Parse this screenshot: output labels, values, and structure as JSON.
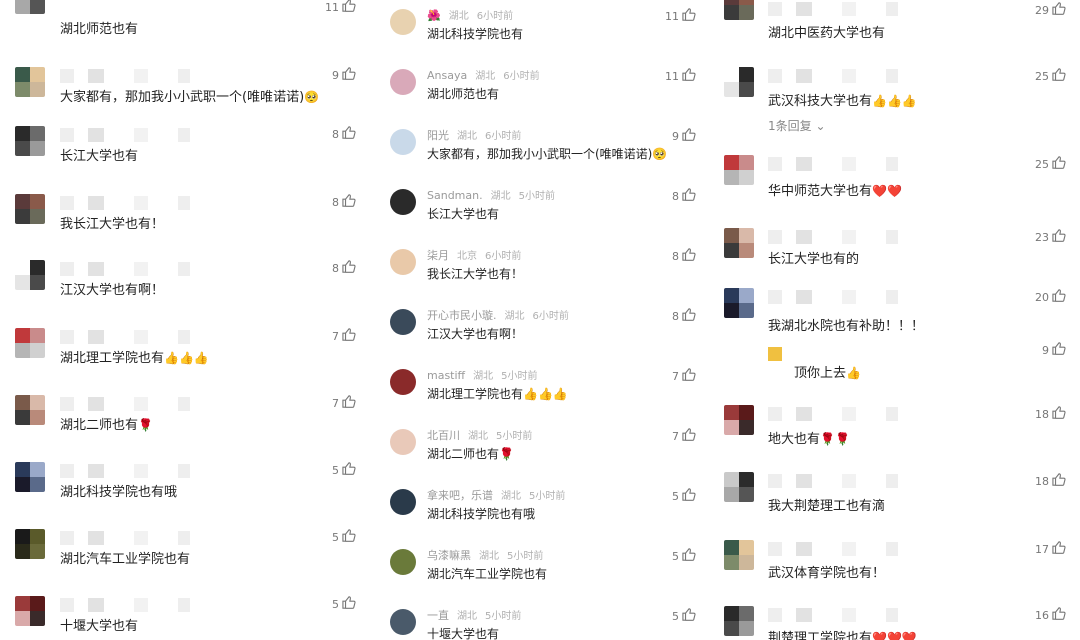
{
  "col1": {
    "comments": [
      {
        "name": "",
        "text": "湖北师范也有",
        "likes": "11"
      },
      {
        "name": "",
        "text": "大家都有，那加我小小武职一个(唯唯诺诺)",
        "suffix": "🥺",
        "likes": "9"
      },
      {
        "name": "",
        "text": "长江大学也有",
        "likes": "8"
      },
      {
        "name": "",
        "text": "我长江大学也有！",
        "likes": "8"
      },
      {
        "name": "",
        "text": "江汉大学也有啊！",
        "likes": "8"
      },
      {
        "name": "",
        "text": "湖北理工学院也有",
        "suffix": "👍👍👍",
        "likes": "7"
      },
      {
        "name": "",
        "text": "湖北二师也有",
        "suffix": "🌹",
        "likes": "7"
      },
      {
        "name": "",
        "text": "湖北科技学院也有哦",
        "likes": "5"
      },
      {
        "name": "",
        "text": "湖北汽车工业学院也有",
        "likes": "5"
      },
      {
        "name": "",
        "text": "十堰大学也有",
        "likes": "5"
      }
    ]
  },
  "col2": {
    "comments": [
      {
        "name": "🌺",
        "location": "湖北",
        "time": "6小时前",
        "text": "湖北科技学院也有",
        "likes": "11"
      },
      {
        "name": "Ansaya",
        "location": "湖北",
        "time": "6小时前",
        "text": "湖北师范也有",
        "likes": "11"
      },
      {
        "name": "阳光",
        "location": "湖北",
        "time": "6小时前",
        "text": "大家都有，那加我小小武职一个(唯唯诺诺)",
        "suffix": "🥺",
        "likes": "9"
      },
      {
        "name": "Sandman.",
        "location": "湖北",
        "time": "5小时前",
        "text": "长江大学也有",
        "likes": "8"
      },
      {
        "name": "柒月",
        "location": "北京",
        "time": "6小时前",
        "text": "我长江大学也有！",
        "likes": "8"
      },
      {
        "name": "开心市民小璇.",
        "location": "湖北",
        "time": "6小时前",
        "text": "江汉大学也有啊！",
        "likes": "8"
      },
      {
        "name": "mastiff",
        "location": "湖北",
        "time": "5小时前",
        "text": "湖北理工学院也有",
        "suffix": "👍👍👍",
        "likes": "7"
      },
      {
        "name": "北百川",
        "location": "湖北",
        "time": "5小时前",
        "text": "湖北二师也有",
        "suffix": "🌹",
        "likes": "7"
      },
      {
        "name": "拿来吧，乐谱",
        "location": "湖北",
        "time": "5小时前",
        "text": "湖北科技学院也有哦",
        "likes": "5"
      },
      {
        "name": "乌漆嘛黑",
        "location": "湖北",
        "time": "5小时前",
        "text": "湖北汽车工业学院也有",
        "likes": "5"
      },
      {
        "name": "一直",
        "location": "湖北",
        "time": "5小时前",
        "text": "十堰大学也有",
        "likes": "5"
      }
    ]
  },
  "col3": {
    "comments": [
      {
        "text": "湖北中医药大学也有",
        "likes": "29"
      },
      {
        "text": "武汉科技大学也有",
        "suffix": "👍👍👍",
        "likes": "25",
        "reply": "1条回复 ⌄"
      },
      {
        "text": "华中师范大学也有",
        "suffix": "❤️❤️",
        "likes": "25"
      },
      {
        "text": "长江大学也有的",
        "likes": "23"
      },
      {
        "text": "我湖北水院也有补助！！！",
        "likes": "20"
      },
      {
        "text": "顶你上去",
        "suffix": "👍",
        "likes": "9"
      },
      {
        "text": "地大也有",
        "suffix": "🌹🌹",
        "likes": "18"
      },
      {
        "text": "我大荆楚理工也有滴",
        "likes": "18"
      },
      {
        "text": "武汉体育学院也有！",
        "likes": "17"
      },
      {
        "text": "荆楚理工学院也有",
        "suffix": "❤️❤️❤️",
        "likes": "16"
      }
    ]
  },
  "colors": {
    "text": "#222222",
    "meta": "#9a9a9a",
    "like": "#777777",
    "reply": "#888888"
  }
}
